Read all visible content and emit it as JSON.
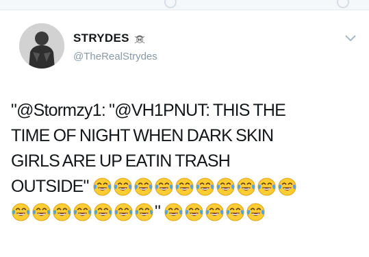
{
  "tweet": {
    "author": {
      "display_name": "STRYDES",
      "handle": "@TheRealStrydes",
      "badge_icon": "pirate-skull-emoji-icon"
    },
    "menu_icon": "chevron-down-icon",
    "text_lines": [
      "\"@Stormzy1: \"@VH1PNUT: THIS THE",
      "TIME OF NIGHT WHEN DARK SKIN",
      "GIRLS ARE UP EATIN TRASH",
      "OUTSIDE\"",
      "\"",
      ""
    ],
    "emoji": {
      "name": "crying-laughing-emoji-icon",
      "line4_count": 10,
      "line5_before_quote": 7,
      "line5_after_quote": 5
    }
  },
  "colors": {
    "text": "#14171a",
    "secondary_text": "#8899a6",
    "emoji_face": "#ffcc33",
    "tears": "#4fa3e0"
  }
}
